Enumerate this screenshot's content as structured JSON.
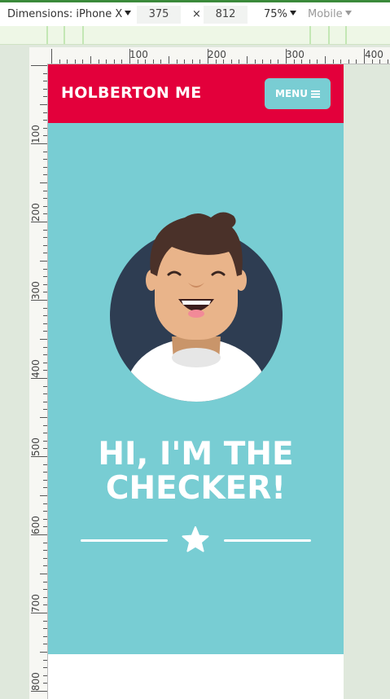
{
  "devtools": {
    "dimensions_label": "Dimensions: iPhone X",
    "width": "375",
    "times": "×",
    "height": "812",
    "zoom": "75%",
    "mode": "Mobile",
    "ruler_top_labels": [
      "100",
      "200",
      "300",
      "400"
    ],
    "ruler_left_labels": [
      "100",
      "200",
      "300",
      "400",
      "500",
      "600",
      "700",
      "800"
    ]
  },
  "site": {
    "brand": "HOLBERTON ME",
    "menu_label": "MENU",
    "hero_title_line1": "HI, I'M THE",
    "hero_title_line2": "CHECKER!"
  },
  "colors": {
    "header": "#e3003b",
    "hero": "#78cdd3",
    "menu_button": "#79cdd3",
    "avatar_circle": "#2e3d52"
  },
  "icons": [
    "caret-down-icon",
    "hamburger-icon",
    "star-icon",
    "avatar-illustration"
  ]
}
